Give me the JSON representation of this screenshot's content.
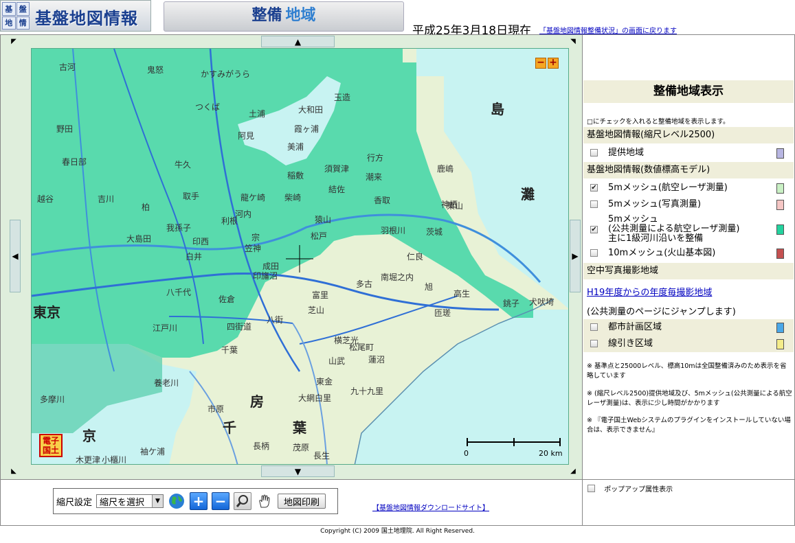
{
  "header": {
    "logo_chars": [
      "基",
      "盤",
      "地",
      "情"
    ],
    "logo_title": "基盤地図情報",
    "tab_part1": "整備",
    "tab_part2": "地域",
    "date": "平成25年3月18日現在",
    "back_link": "「基盤地図情報整備状況」の画面に戻ります"
  },
  "map": {
    "zoom_minus": "−",
    "zoom_plus": "+",
    "denshi_label_1": "電子",
    "denshi_label_2": "国土",
    "scale_start": "0",
    "scale_end": "20 km",
    "arrows": {
      "up": "▲",
      "down": "▼",
      "left": "◀",
      "right": "▶"
    },
    "place_labels": [
      "古河",
      "鬼怒",
      "かすみがうら",
      "つくば",
      "土浦",
      "大和田",
      "玉造",
      "霞ヶ浦",
      "阿見",
      "美浦",
      "行方",
      "島",
      "灘",
      "鹿嶋",
      "神栖",
      "牛久",
      "稲敷",
      "須賀津",
      "潮来",
      "取手",
      "龍ケ崎",
      "柴崎",
      "結佐",
      "香取",
      "我孫子",
      "利根",
      "河内",
      "猿山",
      "松戸",
      "印西",
      "笠神",
      "白井",
      "成田",
      "印旛沼",
      "羽根川",
      "茨城",
      "仁良",
      "八千代",
      "佐倉",
      "八街",
      "多古",
      "南堀之内",
      "旭",
      "高生",
      "銚子",
      "犬吠埼",
      "東京",
      "江戸川",
      "千葉",
      "横芝光",
      "松尾町",
      "山武",
      "蓮沼",
      "大網白里",
      "九十九里",
      "東金",
      "市原",
      "房",
      "千",
      "葉",
      "長柄",
      "茂原",
      "長生",
      "木更津",
      "袖ケ浦",
      "京",
      "多摩川",
      "小櫃川",
      "養老川",
      "芝山",
      "匝瑳",
      "富里",
      "宗",
      "野田",
      "春日部",
      "越谷",
      "吉川",
      "柏",
      "大島田",
      "四街道",
      "栗山"
    ]
  },
  "panel": {
    "title": "整備地域表示",
    "intro": "□にチェックを入れると整備地域を表示します。",
    "section1": "基盤地図情報(縮尺レベル2500)",
    "items1": [
      {
        "label": "提供地域",
        "checked": false,
        "color": "#b8b6e2"
      }
    ],
    "section2": "基盤地図情報(数値標高モデル)",
    "items2": [
      {
        "label": "5mメッシュ(航空レーザ測量)",
        "checked": true,
        "color": "#c9f0c4"
      },
      {
        "label": "5mメッシュ(写真測量)",
        "checked": false,
        "color": "#f5c6c4"
      }
    ],
    "item_multi": {
      "line1": "5mメッシュ",
      "line2": "(公共測量による航空レーザ測量)",
      "line3": "主に1級河川沿いを整備",
      "checked": true,
      "color": "#23d29e"
    },
    "item_10m": {
      "label": "10mメッシュ(火山基本図)",
      "checked": false,
      "color": "#c45050"
    },
    "section3": "空中写真撮影地域",
    "photo_link": "H19年度からの年度毎撮影地域",
    "jump_note": "(公共測量のページにジャンプします)",
    "items3": [
      {
        "label": "都市計画区域",
        "checked": false,
        "color": "#4aa8e8"
      },
      {
        "label": "線引き区域",
        "checked": false,
        "color": "#f4ec8a"
      }
    ],
    "note1": "※ 基準点と25000レベル、標高10mは全国整備済みのため表示を省略しています",
    "note2": "※ (縮尺レベル2500)提供地域及び、5mメッシュ(公共測量による航空レーザ測量)は、表示に少し時間がかかります",
    "note3": "※ 『電子国土Webシステムのプラグインをインストールしていない場合は、表示できません』"
  },
  "toolbar": {
    "scale_label": "縮尺設定",
    "scale_select": "縮尺を選択",
    "print_label": "地図印刷",
    "icons": [
      "globe-icon",
      "zoom-in-icon",
      "zoom-out-icon",
      "magnifier-icon",
      "hand-icon"
    ]
  },
  "download_link": "【基盤地図情報ダウンロードサイト】",
  "popup_label": "ポップアップ属性表示",
  "copyright": "Copyright (C) 2009 国土地理院. All Right Reserved.",
  "colors": {
    "coverage_green": "#3fd6a6",
    "sea": "#c8f3f2",
    "land": "#e6f3d8",
    "road_blue": "#2f6fd6",
    "header_blue": "#1a3f8f"
  }
}
